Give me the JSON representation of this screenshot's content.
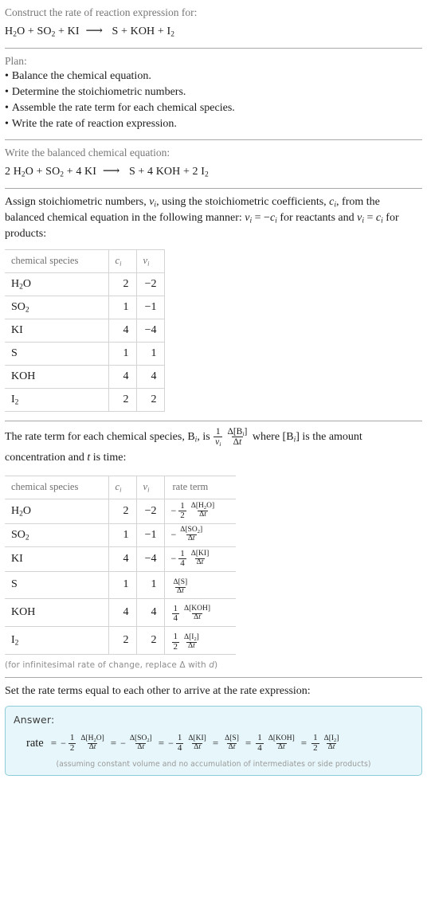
{
  "header": {
    "prompt": "Construct the rate of reaction expression for:",
    "equation": {
      "reactants": [
        {
          "formula": "H2O",
          "coef": ""
        },
        {
          "formula": "SO2",
          "coef": ""
        },
        {
          "formula": "KI",
          "coef": ""
        }
      ],
      "arrow": "⟶",
      "products": [
        {
          "formula": "S",
          "coef": ""
        },
        {
          "formula": "KOH",
          "coef": ""
        },
        {
          "formula": "I2",
          "coef": ""
        }
      ],
      "plain": "H2O + SO2 + KI ⟶ S + KOH + I2"
    }
  },
  "plan": {
    "title": "Plan:",
    "steps": [
      "Balance the chemical equation.",
      "Determine the stoichiometric numbers.",
      "Assemble the rate term for each chemical species.",
      "Write the rate of reaction expression."
    ]
  },
  "balanced": {
    "prompt": "Write the balanced chemical equation:",
    "equation": {
      "reactants": [
        {
          "coef": "2",
          "formula": "H2O"
        },
        {
          "coef": "",
          "formula": "SO2"
        },
        {
          "coef": "4",
          "formula": "KI"
        }
      ],
      "arrow": "⟶",
      "products": [
        {
          "coef": "",
          "formula": "S"
        },
        {
          "coef": "4",
          "formula": "KOH"
        },
        {
          "coef": "2",
          "formula": "I2"
        }
      ],
      "plain": "2 H2O + SO2 + 4 KI ⟶ S + 4 KOH + 2 I2"
    }
  },
  "assign": {
    "text_1": "Assign stoichiometric numbers, ",
    "nu_i": "ν_i",
    "text_2": ", using the stoichiometric coefficients, ",
    "c_i": "c_i",
    "text_3": ", from the balanced chemical equation in the following manner: ",
    "rule_reactants": "ν_i = −c_i",
    "text_4": " for reactants and ",
    "rule_products": "ν_i = c_i",
    "text_5": " for products:"
  },
  "table1": {
    "headers": [
      "chemical species",
      "c_i",
      "ν_i"
    ],
    "rows": [
      {
        "species": "H2O",
        "c": "2",
        "nu": "−2"
      },
      {
        "species": "SO2",
        "c": "1",
        "nu": "−1"
      },
      {
        "species": "KI",
        "c": "4",
        "nu": "−4"
      },
      {
        "species": "S",
        "c": "1",
        "nu": "1"
      },
      {
        "species": "KOH",
        "c": "4",
        "nu": "4"
      },
      {
        "species": "I2",
        "c": "2",
        "nu": "2"
      }
    ]
  },
  "rateterm_intro": {
    "text_1": "The rate term for each chemical species, ",
    "B_i": "B_i",
    "text_2": ", is ",
    "expression": "(1/ν_i)(Δ[B_i]/Δt)",
    "text_3": " where ",
    "bracket": "[B_i]",
    "text_4": " is the amount concentration and ",
    "t": "t",
    "text_5": " is time:"
  },
  "table2": {
    "headers": [
      "chemical species",
      "c_i",
      "ν_i",
      "rate term"
    ],
    "rows": [
      {
        "species": "H2O",
        "c": "2",
        "nu": "−2",
        "sign": "−",
        "coef_num": "1",
        "coef_den": "2",
        "delta": "Δ[H2O]",
        "dt": "Δt"
      },
      {
        "species": "SO2",
        "c": "1",
        "nu": "−1",
        "sign": "−",
        "coef_num": "",
        "coef_den": "",
        "delta": "Δ[SO2]",
        "dt": "Δt"
      },
      {
        "species": "KI",
        "c": "4",
        "nu": "−4",
        "sign": "−",
        "coef_num": "1",
        "coef_den": "4",
        "delta": "Δ[KI]",
        "dt": "Δt"
      },
      {
        "species": "S",
        "c": "1",
        "nu": "1",
        "sign": "",
        "coef_num": "",
        "coef_den": "",
        "delta": "Δ[S]",
        "dt": "Δt"
      },
      {
        "species": "KOH",
        "c": "4",
        "nu": "4",
        "sign": "",
        "coef_num": "1",
        "coef_den": "4",
        "delta": "Δ[KOH]",
        "dt": "Δt"
      },
      {
        "species": "I2",
        "c": "2",
        "nu": "2",
        "sign": "",
        "coef_num": "1",
        "coef_den": "2",
        "delta": "Δ[I2]",
        "dt": "Δt"
      }
    ],
    "footnote": "(for infinitesimal rate of change, replace Δ with d)"
  },
  "final": {
    "prompt": "Set the rate terms equal to each other to arrive at the rate expression:",
    "answer_label": "Answer:",
    "rate_label": "rate",
    "equals": "=",
    "terms": [
      {
        "sign": "−",
        "coef_num": "1",
        "coef_den": "2",
        "delta": "Δ[H2O]",
        "dt": "Δt"
      },
      {
        "sign": "−",
        "coef_num": "",
        "coef_den": "",
        "delta": "Δ[SO2]",
        "dt": "Δt"
      },
      {
        "sign": "−",
        "coef_num": "1",
        "coef_den": "4",
        "delta": "Δ[KI]",
        "dt": "Δt"
      },
      {
        "sign": "",
        "coef_num": "",
        "coef_den": "",
        "delta": "Δ[S]",
        "dt": "Δt"
      },
      {
        "sign": "",
        "coef_num": "1",
        "coef_den": "4",
        "delta": "Δ[KOH]",
        "dt": "Δt"
      },
      {
        "sign": "",
        "coef_num": "1",
        "coef_den": "2",
        "delta": "Δ[I2]",
        "dt": "Δt"
      }
    ],
    "note": "(assuming constant volume and no accumulation of intermediates or side products)",
    "plain": "rate = −1/2 Δ[H2O]/Δt = −Δ[SO2]/Δt = −1/4 Δ[KI]/Δt = Δ[S]/Δt = 1/4 Δ[KOH]/Δt = 1/2 Δ[I2]/Δt"
  },
  "colors": {
    "answer_bg": "#e7f6fa",
    "answer_border": "#8ecdd8",
    "divider": "#a9a9a9",
    "table_border": "#d4d4d4",
    "prompt_text": "#77777a",
    "body_text": "#1b1b1b"
  }
}
